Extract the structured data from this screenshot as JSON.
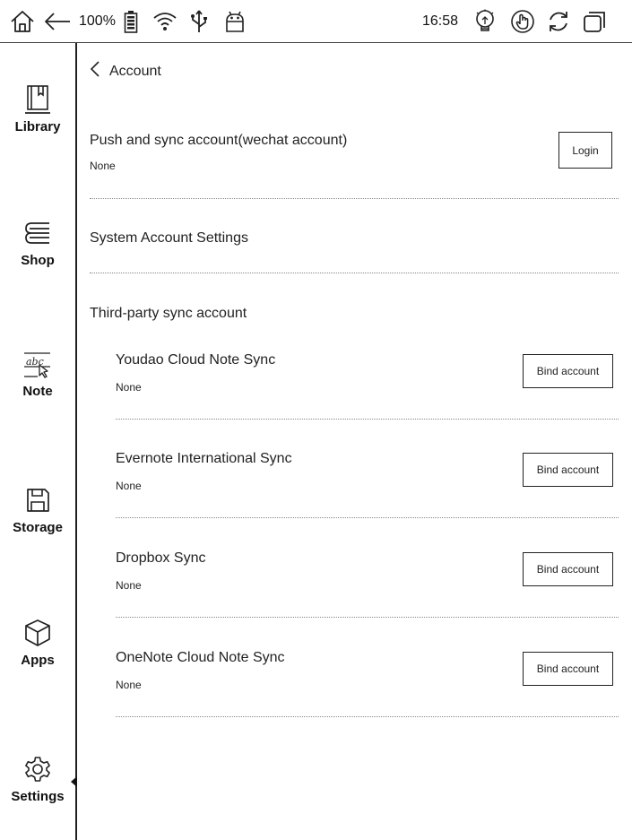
{
  "status_bar": {
    "battery_percent": "100%",
    "time": "16:58",
    "icons": [
      "home-icon",
      "back-arrow-icon",
      "battery-icon",
      "wifi-icon",
      "usb-icon",
      "android-icon",
      "light-bulb-icon",
      "touch-icon",
      "refresh-icon",
      "multitask-icon"
    ]
  },
  "sidebar": {
    "items": [
      {
        "label": "Library",
        "icon": "library-icon"
      },
      {
        "label": "Shop",
        "icon": "shop-icon"
      },
      {
        "label": "Note",
        "icon": "note-icon"
      },
      {
        "label": "Storage",
        "icon": "storage-icon"
      },
      {
        "label": "Apps",
        "icon": "apps-icon"
      },
      {
        "label": "Settings",
        "icon": "settings-icon",
        "active": true
      }
    ]
  },
  "page": {
    "back_label": "Account",
    "push_sync": {
      "title": "Push and sync account(wechat account)",
      "status": "None",
      "button": "Login"
    },
    "system_settings": {
      "title": "System Account Settings"
    },
    "third_party_header": "Third-party sync account",
    "third_party": [
      {
        "title": "Youdao Cloud Note Sync",
        "status": "None",
        "button": "Bind account"
      },
      {
        "title": "Evernote International Sync",
        "status": "None",
        "button": "Bind account"
      },
      {
        "title": "Dropbox Sync",
        "status": "None",
        "button": "Bind account"
      },
      {
        "title": "OneNote Cloud Note Sync",
        "status": "None",
        "button": "Bind account"
      }
    ]
  }
}
